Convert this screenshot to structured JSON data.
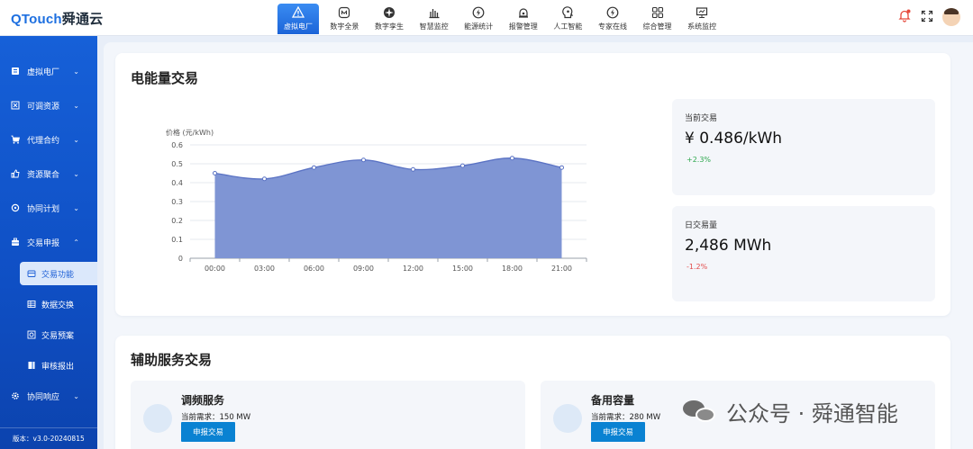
{
  "header": {
    "logo_brand": "QTouch",
    "logo_cn": "舜通云",
    "nav": [
      {
        "label": "虚拟电厂",
        "icon": "warning-triangle-icon",
        "active": true
      },
      {
        "label": "数字全景",
        "icon": "panorama-icon"
      },
      {
        "label": "数字孪生",
        "icon": "twin-icon"
      },
      {
        "label": "智慧监控",
        "icon": "bar-monitor-icon"
      },
      {
        "label": "能源统计",
        "icon": "energy-icon"
      },
      {
        "label": "报警管理",
        "icon": "alarm-gear-icon"
      },
      {
        "label": "人工智能",
        "icon": "ai-head-icon"
      },
      {
        "label": "专家在线",
        "icon": "expert-bolt-icon"
      },
      {
        "label": "综合管理",
        "icon": "grid-manage-icon"
      },
      {
        "label": "系统监控",
        "icon": "system-monitor-icon"
      }
    ]
  },
  "sidebar": {
    "items": [
      {
        "label": "虚拟电厂",
        "icon": "building-icon",
        "chevron": "⌄"
      },
      {
        "label": "可调资源",
        "icon": "resource-icon",
        "chevron": "⌄"
      },
      {
        "label": "代理合约",
        "icon": "cart-icon",
        "chevron": "⌄"
      },
      {
        "label": "资源聚合",
        "icon": "thumb-icon",
        "chevron": "⌄"
      },
      {
        "label": "协同计划",
        "icon": "cycle-icon",
        "chevron": "⌄"
      },
      {
        "label": "交易申报",
        "icon": "briefcase-icon",
        "chevron": "⌃"
      }
    ],
    "sub_items": [
      {
        "label": "交易功能",
        "icon": "card-icon",
        "active": true
      },
      {
        "label": "数据交换",
        "icon": "table-icon"
      },
      {
        "label": "交易预案",
        "icon": "plan-icon"
      },
      {
        "label": "审核报出",
        "icon": "report-icon"
      }
    ],
    "last_item": {
      "label": "协同响应",
      "icon": "gear-icon",
      "chevron": "⌄"
    },
    "version": "版本：v3.0-20240815"
  },
  "energy_trading": {
    "title": "电能量交易",
    "current": {
      "label": "当前交易",
      "value": "¥ 0.486/kWh",
      "change": "+2.3%",
      "change_color": "#2fa84f"
    },
    "daily": {
      "label": "日交易量",
      "value": "2,486 MWh",
      "change": "-1.2%",
      "change_color": "#e34d4d"
    }
  },
  "chart_data": {
    "type": "area",
    "ylabel": "价格 (元/kWh)",
    "xlabel": "",
    "categories": [
      "00:00",
      "03:00",
      "06:00",
      "09:00",
      "12:00",
      "15:00",
      "18:00",
      "21:00"
    ],
    "values": [
      0.45,
      0.42,
      0.48,
      0.52,
      0.47,
      0.49,
      0.53,
      0.48
    ],
    "ylim": [
      0,
      0.6
    ],
    "yticks": [
      "0",
      "0.1",
      "0.2",
      "0.3",
      "0.4",
      "0.5",
      "0.6"
    ],
    "grid": true,
    "smooth": true,
    "fill_color": "#7f95d4",
    "line_color": "#5b73c4"
  },
  "ancillary": {
    "title": "辅助服务交易",
    "services": [
      {
        "name": "调频服务",
        "demand": "当前需求：150 MW",
        "button": "申报交易"
      },
      {
        "name": "备用容量",
        "demand": "当前需求：280 MW",
        "button": "申报交易"
      }
    ]
  },
  "watermark": {
    "text": "公众号 · 舜通智能"
  }
}
